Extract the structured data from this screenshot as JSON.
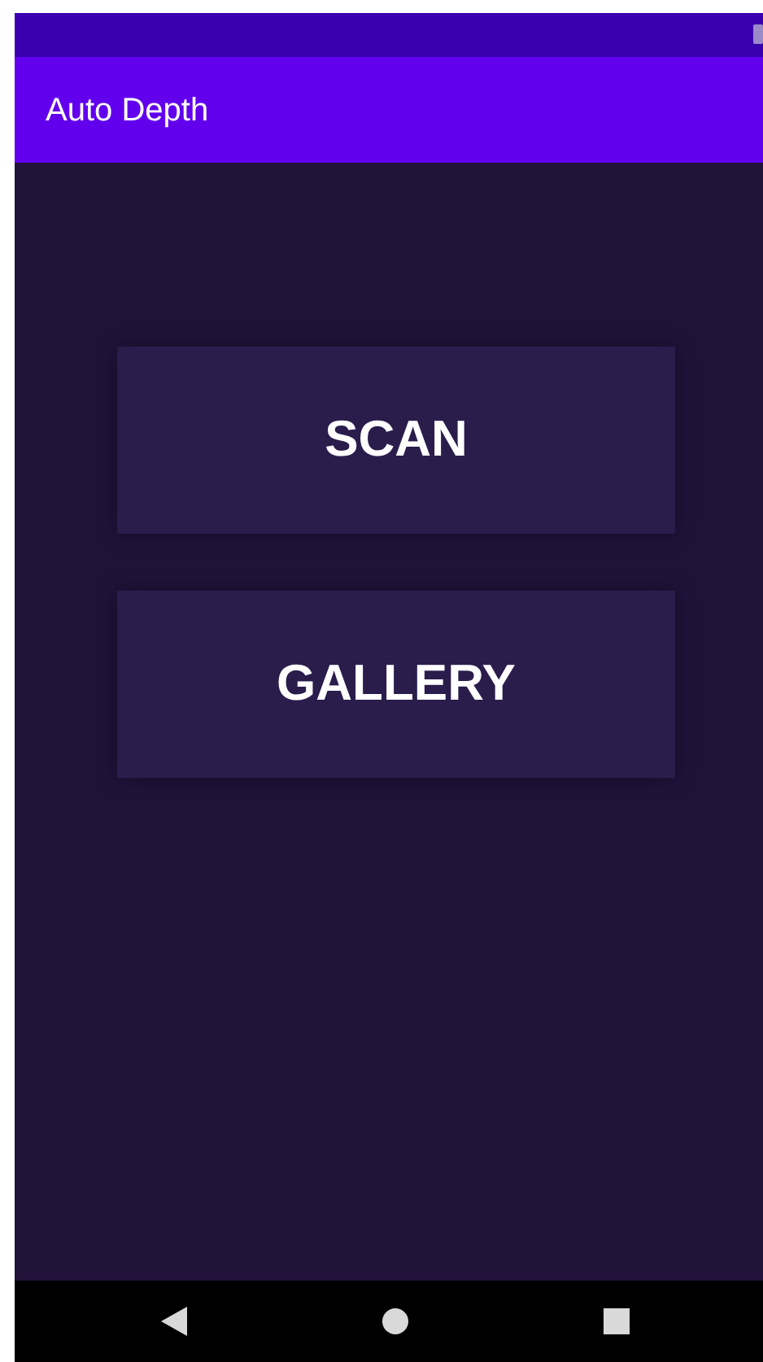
{
  "app_bar": {
    "title": "Auto Depth"
  },
  "buttons": [
    {
      "label": "SCAN"
    },
    {
      "label": "GALLERY"
    }
  ]
}
